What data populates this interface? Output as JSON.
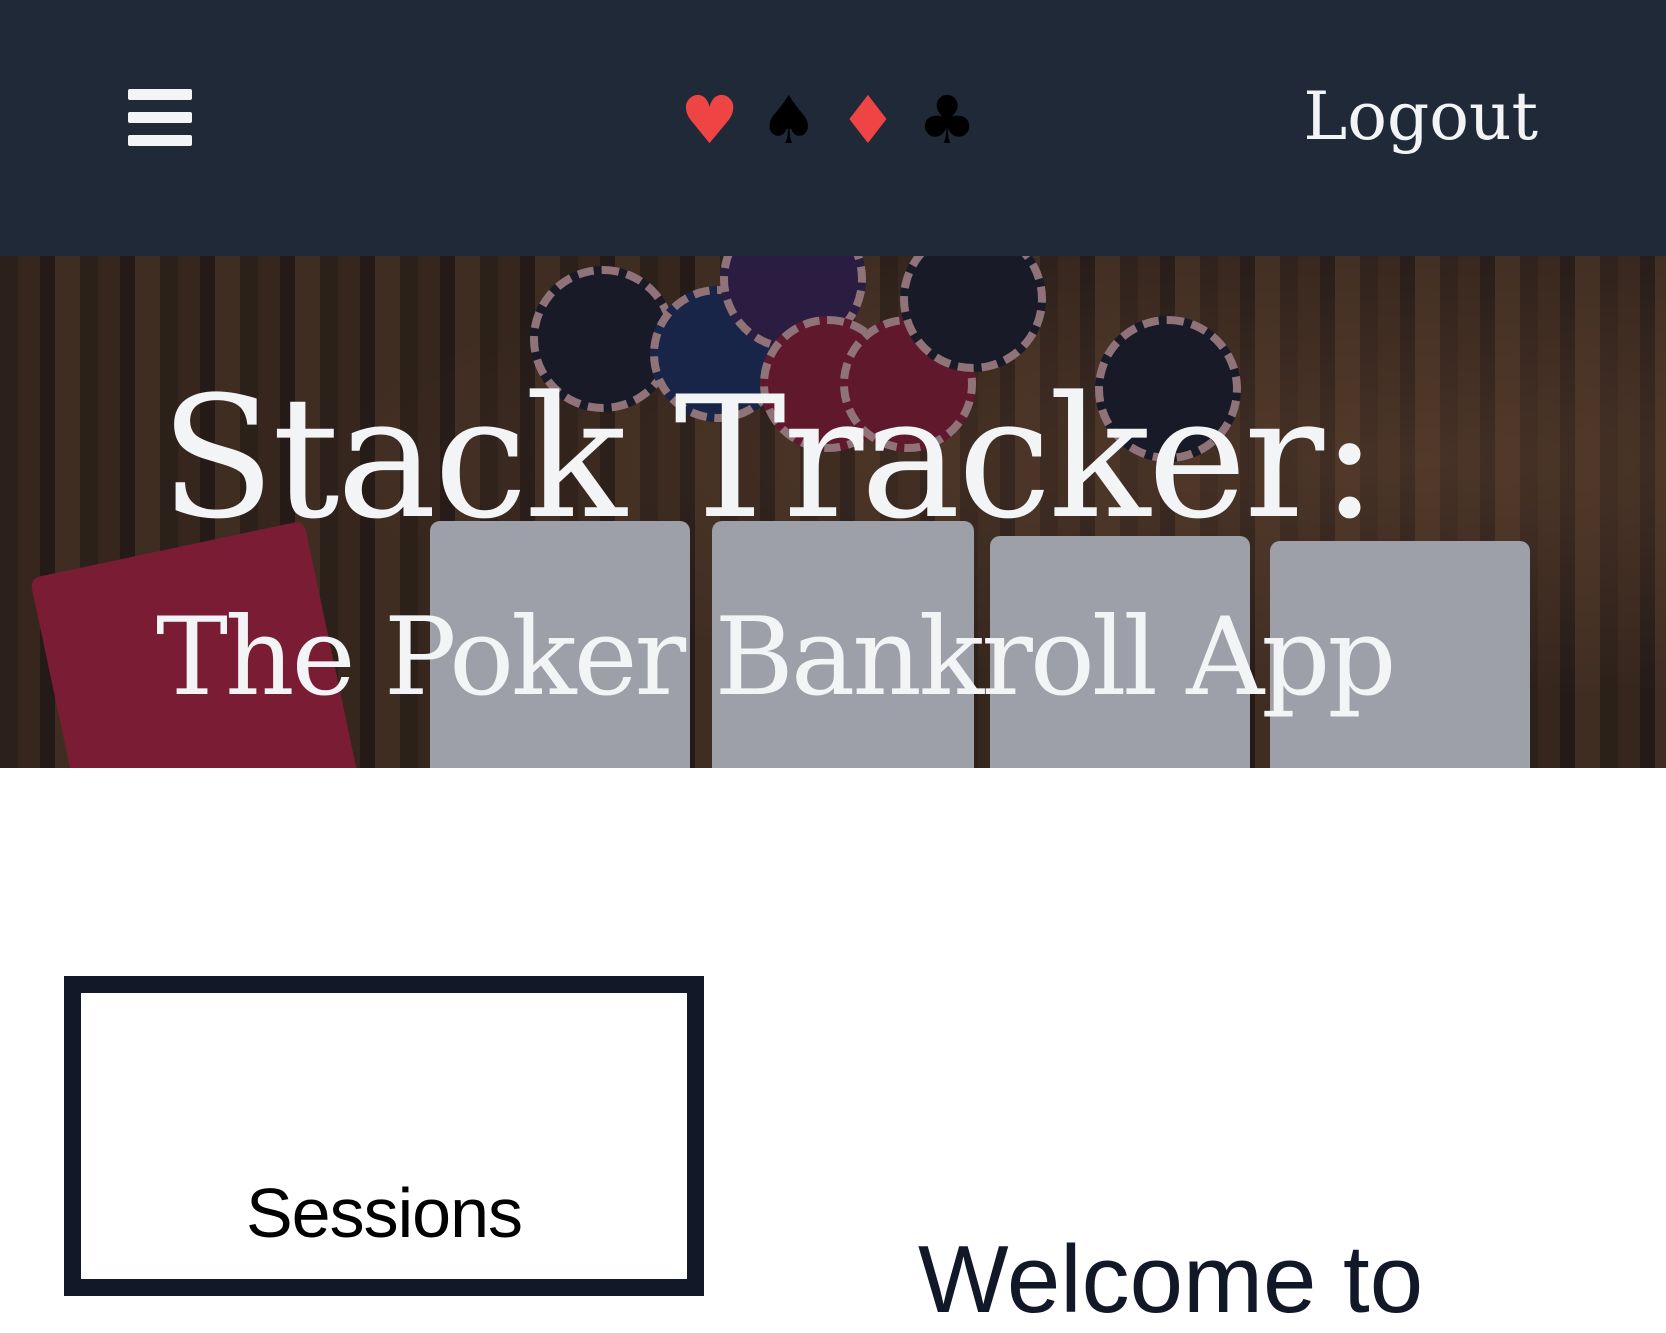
{
  "header": {
    "menu_icon": "hamburger-icon",
    "suits": [
      {
        "icon": "heart-suit-icon",
        "glyph": "♥",
        "color": "#ef4444"
      },
      {
        "icon": "spade-suit-icon",
        "glyph": "♠",
        "color": "#000000"
      },
      {
        "icon": "diamond-suit-icon",
        "glyph": "♦",
        "color": "#ef4444"
      },
      {
        "icon": "club-suit-icon",
        "glyph": "♣",
        "color": "#000000"
      }
    ],
    "logout_label": "Logout"
  },
  "hero": {
    "title": "Stack Tracker:",
    "subtitle": "The Poker Bankroll App"
  },
  "main": {
    "sessions_label": "Sessions",
    "welcome_heading": "Welcome to"
  },
  "colors": {
    "header_bg": "#1f2937",
    "text_dark": "#111827"
  }
}
